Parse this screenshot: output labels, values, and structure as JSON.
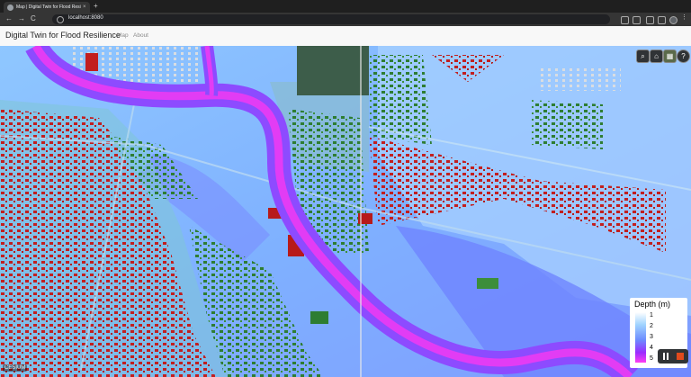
{
  "browser": {
    "tab_title": "Map | Digital Twin for Flood Resi...",
    "tab_close": "×",
    "new_tab": "+",
    "url": "localhost:8080",
    "back": "←",
    "forward": "→",
    "reload": "C"
  },
  "app": {
    "title": "Digital Twin for Flood Resilience",
    "nav": [
      "Map",
      "About"
    ]
  },
  "map": {
    "toolbar": {
      "search_icon": "search-icon",
      "home_icon": "home-icon",
      "basemap_icon": "layers-icon",
      "help_label": "?"
    },
    "legend": {
      "title": "Depth (m)",
      "ticks": [
        "1",
        "2",
        "3",
        "4",
        "5"
      ]
    },
    "credit": "CESIUM",
    "colors": {
      "river": "#a24bff",
      "river_core": "#ff2ee0",
      "flood_shallow": "#9fc8ff",
      "flood_deep": "#6d8cff",
      "building_flooded": "#c21f1f",
      "building_dry": "#2e7d32",
      "stop_button": "#e04a1d"
    }
  }
}
